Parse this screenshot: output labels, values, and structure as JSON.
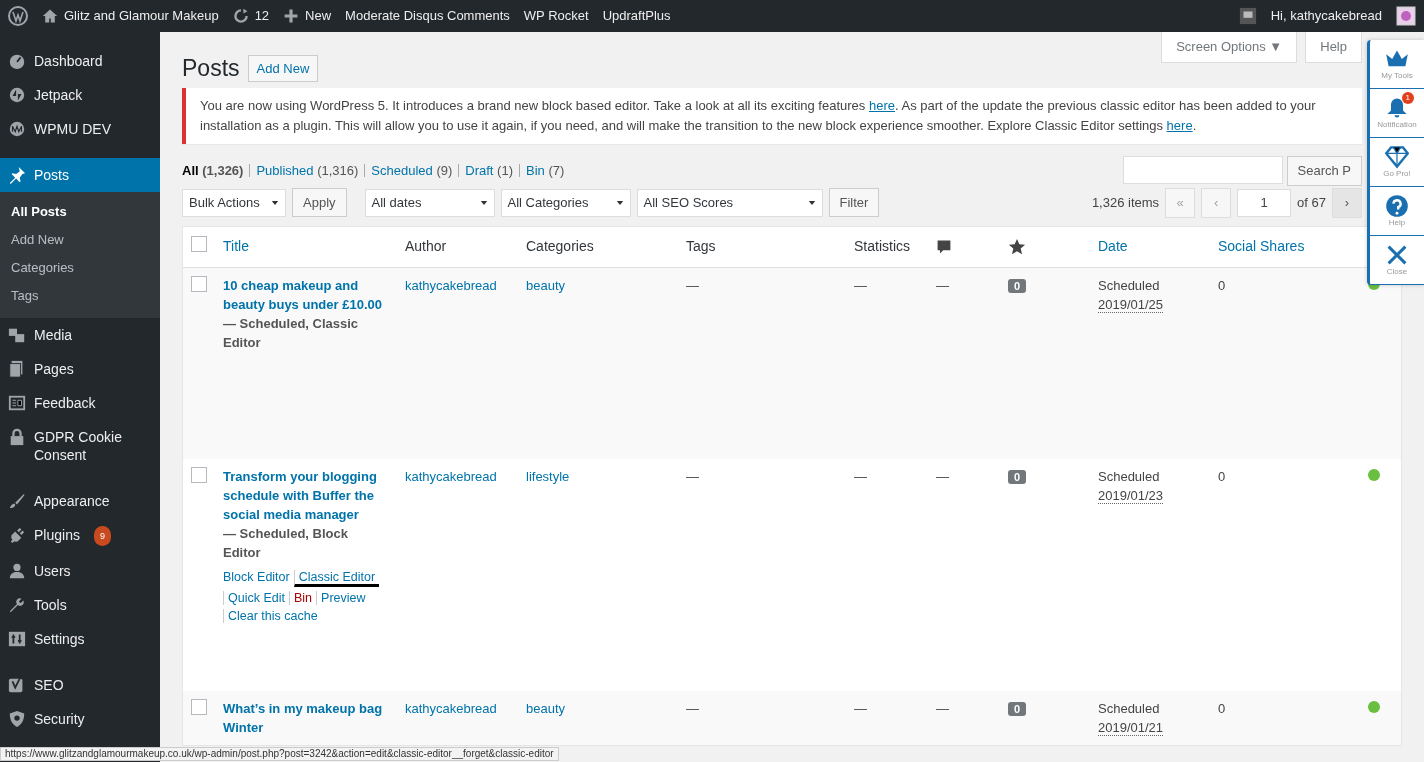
{
  "admin_bar": {
    "site": "Glitz and Glamour Makeup",
    "updates": "12",
    "new": "New",
    "links": [
      "Moderate Disqus Comments",
      "WP Rocket",
      "UpdraftPlus"
    ],
    "greeting": "Hi, kathycakebread"
  },
  "sidebar": {
    "groups": [
      [
        {
          "label": "Dashboard",
          "selected": false
        },
        {
          "label": "Jetpack",
          "selected": false
        },
        {
          "label": "WPMU DEV",
          "selected": false
        }
      ],
      [
        {
          "label": "Posts",
          "selected": true,
          "children": [
            {
              "label": "All Posts",
              "selected": true
            },
            {
              "label": "Add New",
              "selected": false
            },
            {
              "label": "Categories",
              "selected": false
            },
            {
              "label": "Tags",
              "selected": false
            }
          ]
        },
        {
          "label": "Media",
          "selected": false
        },
        {
          "label": "Pages",
          "selected": false
        },
        {
          "label": "Feedback",
          "selected": false
        },
        {
          "label": "GDPR Cookie Consent",
          "selected": false
        }
      ],
      [
        {
          "label": "Appearance",
          "selected": false
        },
        {
          "label": "Plugins",
          "selected": false,
          "badge": "9"
        },
        {
          "label": "Users",
          "selected": false
        },
        {
          "label": "Tools",
          "selected": false
        },
        {
          "label": "Settings",
          "selected": false
        }
      ],
      [
        {
          "label": "SEO",
          "selected": false
        },
        {
          "label": "Security",
          "selected": false
        }
      ]
    ]
  },
  "screen_tabs": [
    "Screen Options ▼",
    "Help"
  ],
  "heading": {
    "title": "Posts",
    "add_new": "Add New"
  },
  "notice": {
    "segments": [
      {
        "kind": "text",
        "text": "You are now using WordPress 5. It introduces a brand new block based editor. Take a look at all its exciting features "
      },
      {
        "kind": "link",
        "text": "here"
      },
      {
        "kind": "text",
        "text": ". As part of the update the previous classic editor has been added to your installation as a plugin. This will allow you to use it again, if you need, and will make the transition to the new block experience smoother. Explore Classic Editor settings "
      },
      {
        "kind": "link",
        "text": "here"
      },
      {
        "kind": "text",
        "text": "."
      }
    ]
  },
  "views": [
    {
      "label": "All",
      "count": "(1,326)",
      "selected": true
    },
    {
      "label": "Published",
      "count": "(1,316)",
      "selected": false
    },
    {
      "label": "Scheduled",
      "count": "(9)",
      "selected": false
    },
    {
      "label": "Draft",
      "count": "(1)",
      "selected": false
    },
    {
      "label": "Bin",
      "count": "(7)",
      "selected": false
    }
  ],
  "search_button": "Search P",
  "filters": {
    "bulk": "Bulk Actions",
    "apply": "Apply",
    "selects": [
      "All dates",
      "All Categories",
      "All SEO Scores"
    ],
    "filter": "Filter"
  },
  "pagination": {
    "items": "1,326 items",
    "first": "«",
    "prev": "‹",
    "page": "1",
    "of": "of 67",
    "next": "›"
  },
  "table": {
    "select_all_checked": false,
    "columns": [
      {
        "kind": "text",
        "label": "Title",
        "sortable": true
      },
      {
        "kind": "text",
        "label": "Author",
        "sortable": false
      },
      {
        "kind": "text",
        "label": "Categories",
        "sortable": false
      },
      {
        "kind": "text",
        "label": "Tags",
        "sortable": false
      },
      {
        "kind": "text",
        "label": "Statistics",
        "sortable": false
      },
      {
        "kind": "comment-icon"
      },
      {
        "kind": "star-icon"
      },
      {
        "kind": "text",
        "label": "Date",
        "sortable": true
      },
      {
        "kind": "text",
        "label": "Social Shares",
        "sortable": true
      }
    ],
    "rows": [
      {
        "checked": false,
        "title": "10 cheap makeup and beauty buys under £10.00",
        "state": " — Scheduled, Classic Editor",
        "author": "kathycakebread",
        "category": "beauty",
        "tags": "—",
        "statistics": "—",
        "comments": "—",
        "rating": "0",
        "date_status": "Scheduled",
        "date": "2019/01/25",
        "shares": "0",
        "color": "#6abf40"
      },
      {
        "checked": false,
        "title": "Transform your blogging schedule with Buffer the social media manager",
        "state": " — Scheduled, Block Editor",
        "author": "kathycakebread",
        "category": "lifestyle",
        "tags": "—",
        "statistics": "—",
        "comments": "—",
        "rating": "0",
        "date_status": "Scheduled",
        "date": "2019/01/23",
        "shares": "0",
        "color": "#6abf40",
        "actions": [
          {
            "label": "Block Editor",
            "kind": "link",
            "marked": false
          },
          {
            "label": "Classic Editor",
            "kind": "link",
            "marked": true
          },
          {
            "label": "Quick Edit",
            "kind": "link",
            "marked": false
          },
          {
            "label": "Bin",
            "kind": "danger",
            "marked": false
          },
          {
            "label": "Preview",
            "kind": "link",
            "marked": false
          },
          {
            "label": "Clear this cache",
            "kind": "link",
            "marked": false
          }
        ]
      },
      {
        "checked": false,
        "title": "What’s in my makeup bag Winter",
        "author": "kathycakebread",
        "category": "beauty",
        "tags": "—",
        "statistics": "—",
        "comments": "—",
        "rating": "0",
        "date_status": "Scheduled",
        "date": "2019/01/21",
        "shares": "0",
        "color": "#6abf40"
      }
    ]
  },
  "tool_panel": [
    {
      "label": "My Tools"
    },
    {
      "label": "Notification",
      "badge": "1"
    },
    {
      "label": "Go Pro!"
    },
    {
      "label": "Help"
    },
    {
      "label": "Close"
    }
  ],
  "status_url": "https://www.glitzandglamourmakeup.co.uk/wp-admin/post.php?post=3242&action=edit&classic-editor__forget&classic-editor"
}
